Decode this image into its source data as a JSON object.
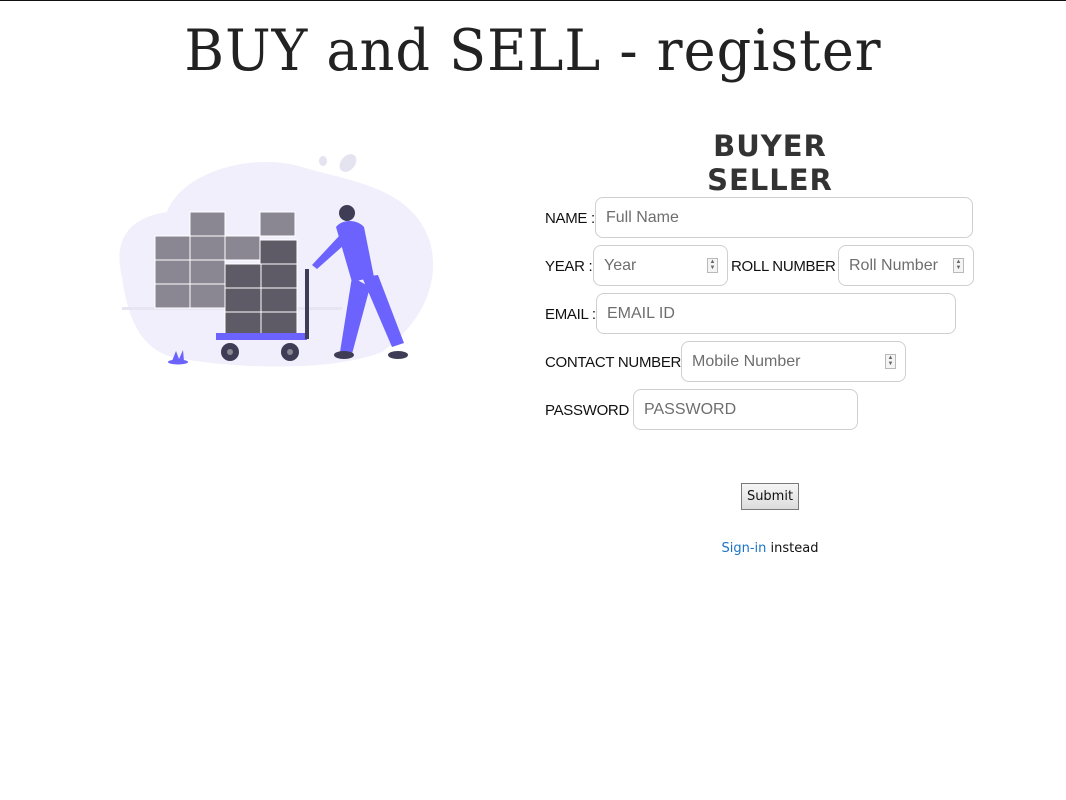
{
  "page": {
    "title": "BUY and SELL - register"
  },
  "form": {
    "heading": "BUYER SELLER",
    "name": {
      "label": "NAME :",
      "placeholder": "Full Name",
      "value": ""
    },
    "year": {
      "label": "YEAR :",
      "placeholder": "Year",
      "value": ""
    },
    "roll_number": {
      "label": "ROLL NUMBER :",
      "placeholder": "Roll Number",
      "value": ""
    },
    "email": {
      "label": "EMAIL :",
      "placeholder": "EMAIL ID",
      "value": ""
    },
    "contact_number": {
      "label": "CONTACT NUMBER :",
      "placeholder": "Mobile Number",
      "value": ""
    },
    "password": {
      "label": "PASSWORD :",
      "placeholder": "PASSWORD",
      "value": ""
    },
    "submit_label": "Submit"
  },
  "signin": {
    "link_text": "Sign-in",
    "suffix_text": " instead"
  },
  "illustration": {
    "icon": "delivery-person-with-boxes",
    "colors": {
      "accent": "#6c63ff",
      "background_blob": "#f0effb",
      "box": "#8a8793",
      "box_dark": "#5e5b67"
    }
  },
  "colors": {
    "link": "#1a73c8",
    "field_border": "#cfcfcf"
  }
}
